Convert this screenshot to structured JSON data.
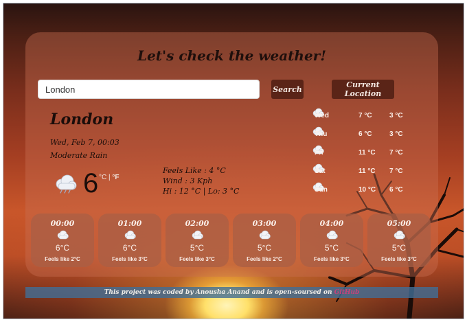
{
  "app": {
    "title": "Let's check the weather!"
  },
  "search": {
    "value": "London",
    "placeholder": "",
    "search_label": "Search",
    "location_label": "Current Location"
  },
  "current": {
    "city": "London",
    "date": "Wed, Feb 7, 00:03",
    "description": "Moderate Rain",
    "icon": "rain-cloud-icon",
    "temp": "6",
    "unit_c": "°C",
    "unit_separator": " | ",
    "unit_f": "°F",
    "feels_like": "Feels Like : 4 °C",
    "wind": "Wind : 3 Kph",
    "hi_lo": "Hi : 12 °C | Lo: 3 °C"
  },
  "daily": [
    {
      "day": "Wed",
      "hi": "7 °C",
      "lo": "3 °C",
      "icon": "cloud-icon"
    },
    {
      "day": "Thu",
      "hi": "6 °C",
      "lo": "3 °C",
      "icon": "cloud-icon"
    },
    {
      "day": "Fri",
      "hi": "11 °C",
      "lo": "7 °C",
      "icon": "cloud-icon"
    },
    {
      "day": "Sat",
      "hi": "11 °C",
      "lo": "7 °C",
      "icon": "cloud-icon"
    },
    {
      "day": "Sun",
      "hi": "10 °C",
      "lo": "6 °C",
      "icon": "cloud-icon"
    }
  ],
  "hourly": [
    {
      "time": "00:00",
      "temp": "6°C",
      "feels": "Feels like 2°C",
      "icon": "cloud-icon"
    },
    {
      "time": "01:00",
      "temp": "6°C",
      "feels": "Feels like 3°C",
      "icon": "cloud-icon"
    },
    {
      "time": "02:00",
      "temp": "5°C",
      "feels": "Feels like 3°C",
      "icon": "cloud-icon"
    },
    {
      "time": "03:00",
      "temp": "5°C",
      "feels": "Feels like 2°C",
      "icon": "cloud-icon"
    },
    {
      "time": "04:00",
      "temp": "5°C",
      "feels": "Feels like 3°C",
      "icon": "cloud-icon"
    },
    {
      "time": "05:00",
      "temp": "5°C",
      "feels": "Feels like 3°C",
      "icon": "cloud-icon"
    }
  ],
  "footer": {
    "text": "This project was coded by Anousha Anand and is open-soursed on ",
    "link_label": "GitHub"
  },
  "colors": {
    "button_bg": "#5a2417",
    "footer_bg": "#416e96",
    "link": "#c7427b"
  }
}
